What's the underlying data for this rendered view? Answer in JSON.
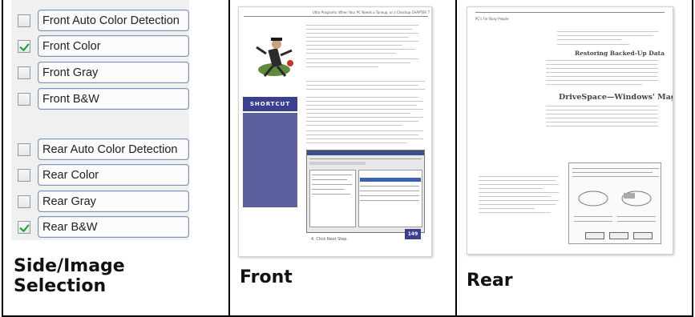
{
  "options": [
    {
      "label": "Front Auto Color Detection",
      "checked": false
    },
    {
      "label": "Front Color",
      "checked": true
    },
    {
      "label": "Front Gray",
      "checked": false
    },
    {
      "label": "Front B&W",
      "checked": false
    },
    {
      "label": "Rear Auto Color Detection",
      "checked": false
    },
    {
      "label": "Rear Color",
      "checked": false
    },
    {
      "label": "Rear Gray",
      "checked": false
    },
    {
      "label": "Rear B&W",
      "checked": true
    }
  ],
  "captions": {
    "side": "Side/Image Selection",
    "front": "Front",
    "rear": "Rear"
  },
  "front_page": {
    "header": "Ultra Programs: When Your PC Needs a Tuneup, or a Checkup  CHAPTER 7",
    "sidebar_title": "SHORTCUT",
    "page_number": "149",
    "footer_text": "4. Click Next Step."
  },
  "rear_page": {
    "header": "PC's For Busy People",
    "heading1": "Restoring Backed-Up Data",
    "heading2": "DriveSpace—Windows' Magic Act"
  }
}
